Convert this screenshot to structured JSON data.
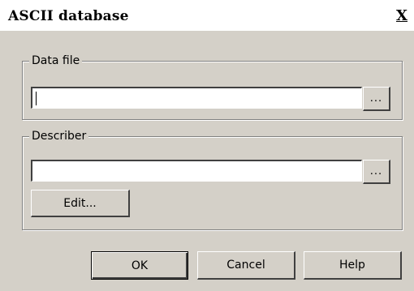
{
  "window": {
    "title": "ASCII database",
    "close_label": "X"
  },
  "data_file_group": {
    "legend": "Data file",
    "input_value": "",
    "browse_label": "..."
  },
  "describer_group": {
    "legend": "Describer",
    "input_value": "",
    "browse_label": "...",
    "edit_label": "Edit..."
  },
  "buttons": {
    "ok": "OK",
    "cancel": "Cancel",
    "help": "Help"
  },
  "colors": {
    "face": "#d4d0c8",
    "title_bg": "#ffffff"
  }
}
